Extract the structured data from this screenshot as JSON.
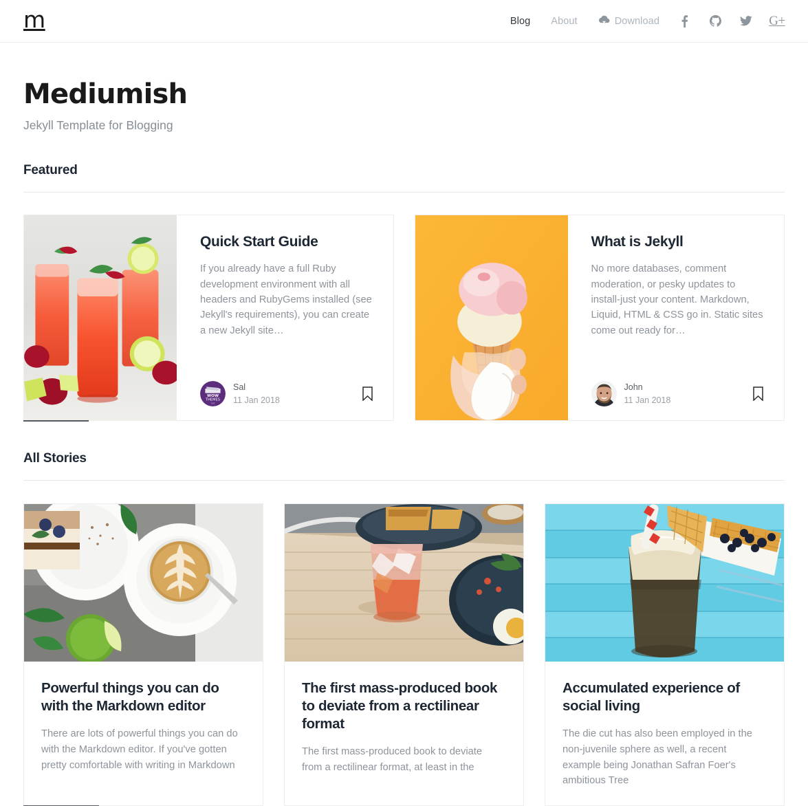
{
  "navbar": {
    "brand": "m",
    "links": [
      {
        "label": "Blog",
        "active": true
      },
      {
        "label": "About",
        "active": false
      }
    ],
    "download_label": "Download",
    "download_icon": "cloud-download-icon",
    "social": [
      {
        "name": "facebook-icon",
        "label": "f"
      },
      {
        "name": "github-icon",
        "label": ""
      },
      {
        "name": "twitter-icon",
        "label": ""
      },
      {
        "name": "google-plus-icon",
        "label": "G+"
      }
    ]
  },
  "header": {
    "title": "Mediumish",
    "subtitle": "Jekyll Template for Blogging"
  },
  "featured": {
    "section_title": "Featured",
    "cards": [
      {
        "title": "Quick Start Guide",
        "excerpt": "If you already have a full Ruby development environment with all headers and RubyGems installed (see Jekyll's requirements), you can create a new Jekyll site…",
        "author": "Sal",
        "date": "11 Jan 2018",
        "avatar": "wow-themes-logo-avatar",
        "thumb_alt": "strawberry-cocktails-photo",
        "bookmark_icon": "bookmark-icon"
      },
      {
        "title": "What is Jekyll",
        "excerpt": "No more databases, comment moderation, or pesky updates to install-just your content. Markdown, Liquid, HTML & CSS go in. Static sites come out ready for…",
        "author": "John",
        "date": "11 Jan 2018",
        "avatar": "photo-portrait-avatar",
        "thumb_alt": "ice-cream-cone-photo",
        "bookmark_icon": "bookmark-icon"
      }
    ]
  },
  "all_stories": {
    "section_title": "All Stories",
    "cards": [
      {
        "title": "Powerful things you can do with the Markdown editor",
        "excerpt": "There are lots of powerful things you can do with the Markdown editor. If you've gotten pretty comfortable with writing in Markdown",
        "thumb_alt": "latte-art-tiramisu-photo"
      },
      {
        "title": "The first mass-produced book to deviate from a rectilinear format",
        "excerpt": "The first mass-produced book to deviate from a rectilinear format, at least in the",
        "thumb_alt": "cocktail-on-wood-table-photo"
      },
      {
        "title": "Accumulated experience of social living",
        "excerpt": "The die cut has also been employed in the non-juvenile sphere as well, a recent example being Jonathan Safran Foer's ambitious Tree",
        "thumb_alt": "iced-drink-blue-planks-photo"
      }
    ]
  },
  "colors": {
    "text_dark": "#1d2733",
    "text_muted": "#8d949c",
    "nav_muted": "#adb5bd",
    "border": "#ededed",
    "accent_rule": "#555a61",
    "avatar_purple": "#5c2d7d"
  }
}
